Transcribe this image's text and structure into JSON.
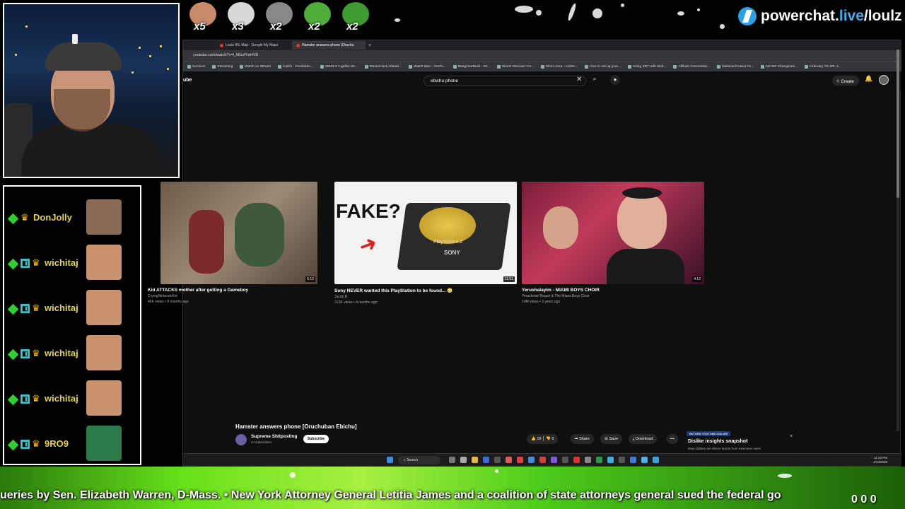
{
  "overlay": {
    "brand": {
      "prefix": "powerchat.",
      "live": "live",
      "suffix": "/loulz"
    },
    "emotes": [
      {
        "name": "emote-face-1",
        "mult": "x5",
        "color": "#c98a6a"
      },
      {
        "name": "emote-cat",
        "mult": "x3",
        "color": "#d8d8d8"
      },
      {
        "name": "emote-3",
        "mult": "x2",
        "color": "#888888"
      },
      {
        "name": "emote-pepe-1",
        "mult": "x2",
        "color": "#4fae3a"
      },
      {
        "name": "emote-pepe-2",
        "mult": "x2",
        "color": "#3f9c30"
      }
    ],
    "ticker_text": "ueries by Sen. Elizabeth Warren, D-Mass.        •        New York Attorney General Letitia James and a coalition of state attorneys general sued the federal go",
    "counter": "0 0 0"
  },
  "chat": {
    "messages": [
      {
        "user": "DonJolly",
        "badge": false,
        "avatar_color": "#8a6a55"
      },
      {
        "user": "wichitaj",
        "badge": true,
        "avatar_color": "#c9916e"
      },
      {
        "user": "wichitaj",
        "badge": true,
        "avatar_color": "#c9916e"
      },
      {
        "user": "wichitaj",
        "badge": true,
        "avatar_color": "#c9916e"
      },
      {
        "user": "wichitaj",
        "badge": true,
        "avatar_color": "#c9916e"
      },
      {
        "user": "9RO9",
        "badge": true,
        "avatar_color": "#2c7a4a"
      }
    ]
  },
  "browser": {
    "tabs": [
      {
        "label": "Loulz IRL Map - Google My Maps",
        "active": false
      },
      {
        "label": "Hamster answers phone [Oruchu",
        "active": true
      }
    ],
    "new_tab": "+",
    "url": "youtube.com/watch?v=t_bBcdYwHV8",
    "bookmarks": [
      "Services",
      "Streaming",
      "Watch on Stream",
      "Kalshi - Prediction...",
      "XM43-2 1-gallon 32...",
      "DreamHack Atlanta...",
      "Watch later - YouTu...",
      "BangYourBuck - 32...",
      "Skool: Discover Co...",
      "Client Area - AntiSc...",
      "How to set up your...",
      "Using SRT with Mob...",
      "Affiliate Commissio...",
      "National Peanut Fe...",
      "NE MS Champions...",
      "February 7th-8th, 2..."
    ],
    "logo_fragment": "ube",
    "search_query": "ebichu phone",
    "create_label": "Create"
  },
  "youtube": {
    "endscreen": [
      {
        "title": "Kid ATTACKS mother after getting a Gameboy",
        "channel": "CryingNintendoKid",
        "meta": "46K views • 8 months ago",
        "duration": "5:12"
      },
      {
        "title": "Sony NEVER wanted this PlayStation to be found... 😳",
        "channel": "Jacob R",
        "meta": "312K views • 4 months ago",
        "duration": "11:51",
        "overlay_text": "FAKE?",
        "disc_text": "PlayStation.2",
        "brand_text": "SONY"
      },
      {
        "title": "Yerushalayim - MIAMI BOYS CHOIR",
        "channel": "Yerachmiel Begun & The Miami Boys Choir",
        "meta": "10M views • 3 years ago",
        "duration": "4:12"
      }
    ],
    "video": {
      "title": "Hamster answers phone [Oruchuban Ebichu]",
      "channel": "Supreme Shitposting",
      "subs": "24 subscribers",
      "subscribe": "Subscribe",
      "likes": "15",
      "dislikes": "0",
      "share": "Share",
      "save": "Save",
      "download": "Download",
      "more": "•••"
    },
    "dislike_panel": {
      "tag": "RETURN YOUTUBE DISLIKE",
      "title": "Dislike insights snapshot",
      "subtitle": "Raw dislikes are direct reports from extension users",
      "close": "×"
    }
  },
  "taskbar": {
    "search": "Search",
    "time": "11:23 PM",
    "date": "1/13/2026"
  }
}
